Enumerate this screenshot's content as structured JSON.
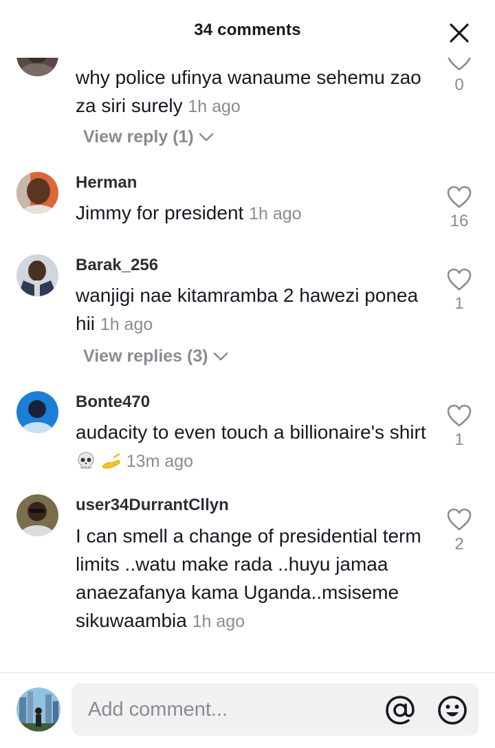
{
  "header": {
    "title": "34 comments"
  },
  "comments": [
    {
      "username": "",
      "text": "why police ufinya wanaume sehemu zao za siri surely",
      "time": "1h ago",
      "likes": "0",
      "reply_label": "View reply (1)"
    },
    {
      "username": "Herman",
      "text": "Jimmy for president",
      "time": "1h ago",
      "likes": "16"
    },
    {
      "username": "Barak_256",
      "text": "wanjigi nae kitamramba 2 hawezi ponea hii",
      "time": "1h ago",
      "likes": "1",
      "reply_label": "View replies (3)"
    },
    {
      "username": "Bonte470",
      "text": "audacity to even touch a billionaire's shirt",
      "emojis": [
        "skull-emoji",
        "writing-hand-emoji"
      ],
      "time": "13m ago",
      "likes": "1"
    },
    {
      "username": "user34DurrantCllyn",
      "text": "I can smell a change of presidential term limits ..watu make rada ..huyu jamaa anaezafanya kama Uganda..msiseme sikuwaambia",
      "time": "1h ago",
      "likes": "2"
    }
  ],
  "composer": {
    "placeholder": "Add comment..."
  },
  "icons": {
    "close": "close-icon",
    "like": "heart-outline-icon",
    "expand": "chevron-down-icon",
    "mention": "at-sign-icon",
    "emoji": "smiley-face-icon"
  },
  "colors": {
    "text": "#161823",
    "muted": "#8a8b91",
    "input_bg": "#f1f1f2"
  }
}
